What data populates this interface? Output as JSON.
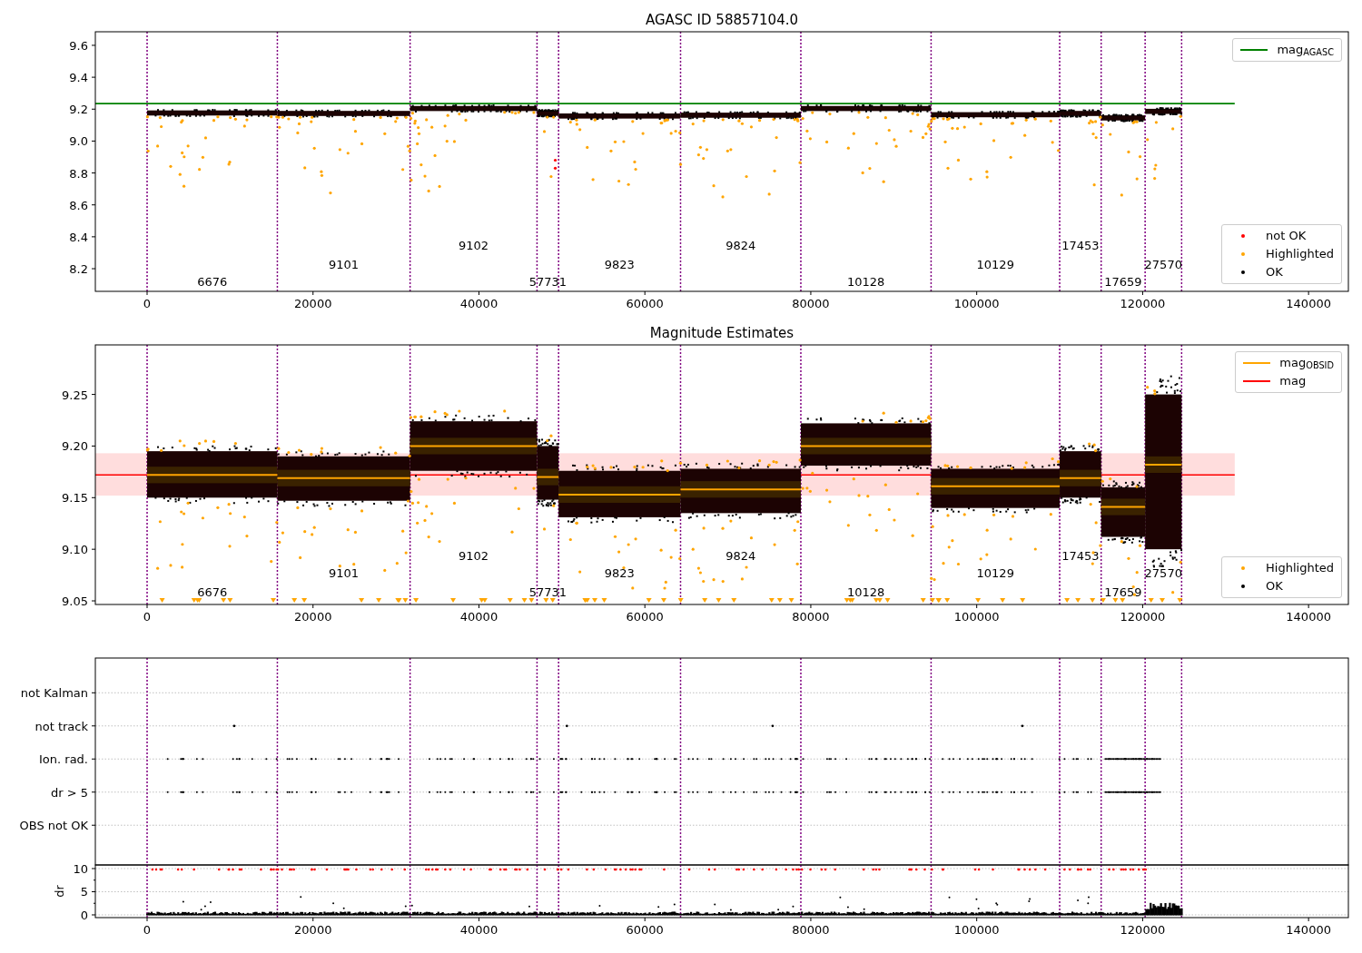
{
  "panels": [
    {
      "kind": "agasc",
      "chart_data": {
        "type": "scatter",
        "title": "AGASC ID 58857104.0",
        "xlim": [
          -6240,
          144800
        ],
        "ylim": [
          8.058,
          9.685
        ],
        "xticks": [
          0,
          20000,
          40000,
          60000,
          80000,
          100000,
          120000,
          140000
        ],
        "yticks": [
          8.2,
          8.4,
          8.6,
          8.8,
          {
            "value": 9,
            "label": "9.0"
          },
          9.2,
          9.4,
          9.6
        ],
        "ref_lines": [
          {
            "axis": "y",
            "value": 9.235,
            "color": "#008000"
          }
        ],
        "annotations": [
          "6676",
          "9101",
          "9102",
          "57731",
          "9823",
          "9824",
          "10128",
          "10129",
          "17453",
          "17659",
          "27570"
        ]
      },
      "legends": [
        [
          {
            "kind": "line",
            "label": "mag$_{AGASC}$",
            "color": "#008000"
          }
        ],
        [
          {
            "kind": "dot",
            "label": "not OK",
            "color": "#ff0000"
          },
          {
            "kind": "dot",
            "label": "Highlighted",
            "color": "#ffa500"
          },
          {
            "kind": "dot",
            "label": "OK",
            "color": "#000000"
          }
        ]
      ]
    },
    {
      "kind": "estimates",
      "chart_data": {
        "type": "scatter",
        "title": "Magnitude Estimates",
        "xlim": [
          -6240,
          144800
        ],
        "ylim": [
          9.0465,
          9.298
        ],
        "xticks": [
          0,
          20000,
          40000,
          60000,
          80000,
          100000,
          120000,
          140000
        ],
        "yticks": [
          9.05,
          {
            "value": 9.1,
            "label": "9.10"
          },
          9.15,
          {
            "value": 9.2,
            "label": "9.20"
          },
          9.25
        ],
        "ref_lines": [
          {
            "axis": "y",
            "value": 9.172,
            "color": "#ff0000"
          }
        ],
        "bands": [
          {
            "axis": "y",
            "from": 9.152,
            "to": 9.193,
            "color": "#ffdddd"
          }
        ],
        "annotations": [
          "6676",
          "9101",
          "9102",
          "57731",
          "9823",
          "9824",
          "10128",
          "10129",
          "17453",
          "17659",
          "27570"
        ]
      },
      "legends": [
        [
          {
            "kind": "line",
            "label": "mag$_{OBSID}$",
            "color": "#ffa500"
          },
          {
            "kind": "line",
            "label": "mag",
            "color": "#ff0000"
          }
        ],
        [
          {
            "kind": "dot",
            "label": "Highlighted",
            "color": "#ffa500"
          },
          {
            "kind": "dot",
            "label": "OK",
            "color": "#000000"
          }
        ]
      ]
    },
    {
      "kind": "flags",
      "chart_data": {
        "type": "scatter",
        "orientation": "horizontal",
        "grid": true,
        "xlim": [
          -6240,
          144800
        ],
        "categories": [
          "not Kalman",
          "not track",
          "Ion. rad.",
          "dr > 5",
          "OBS not OK"
        ]
      }
    },
    {
      "kind": "dr",
      "chart_data": {
        "type": "scatter",
        "grid": true,
        "ylabel": "dr",
        "xlim": [
          -6240,
          144800
        ],
        "ylim": [
          -0.59,
          10.78
        ],
        "xticks": [
          0,
          20000,
          40000,
          60000,
          80000,
          100000,
          120000,
          140000
        ],
        "yticks": [
          0,
          5,
          10
        ]
      }
    }
  ]
}
